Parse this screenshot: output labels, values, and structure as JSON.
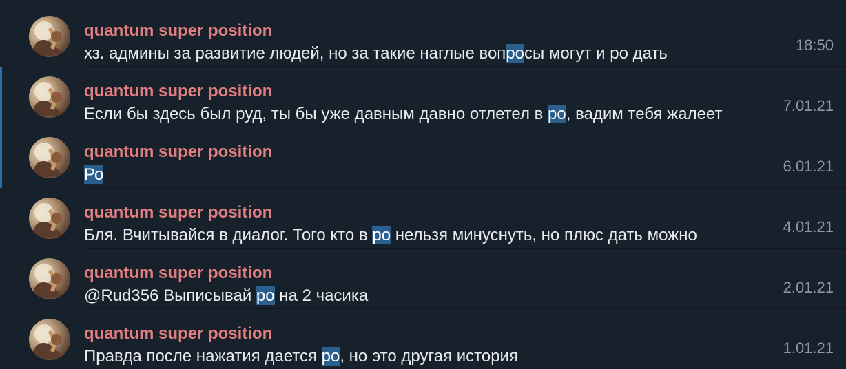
{
  "colors": {
    "background": "#17212b",
    "sender": "#e27e80",
    "text": "#e8eaed",
    "highlight": "#2b5f8e",
    "date": "#8d98a4"
  },
  "results": [
    {
      "sender": "quantum super position",
      "text_before": "хз. админы за развитие людей, но за такие наглые воп",
      "highlight": "ро",
      "text_after": "сы могут и ро дать",
      "date": "18:50"
    },
    {
      "sender": "quantum super position",
      "text_before": "Если бы здесь был руд, ты бы уже давным давно отлетел в ",
      "highlight": "ро",
      "text_after": ", вадим тебя жалеет",
      "date": "7.01.21"
    },
    {
      "sender": "quantum super position",
      "text_before": "",
      "highlight": "Ро",
      "text_after": "",
      "date": "6.01.21"
    },
    {
      "sender": "quantum super position",
      "text_before": "Бля. Вчитывайся в диалог.  Того кто в ",
      "highlight": "ро",
      "text_after": " нельзя минуснуть, но плюс дать можно",
      "date": "4.01.21"
    },
    {
      "sender": "quantum super position",
      "text_before": "@Rud356 Выписывай ",
      "highlight": "ро",
      "text_after": " на 2 часика",
      "date": "2.01.21"
    },
    {
      "sender": "quantum super position",
      "text_before": "Правда после нажатия дается ",
      "highlight": "ро",
      "text_after": ", но это другая история",
      "date": "1.01.21"
    }
  ]
}
